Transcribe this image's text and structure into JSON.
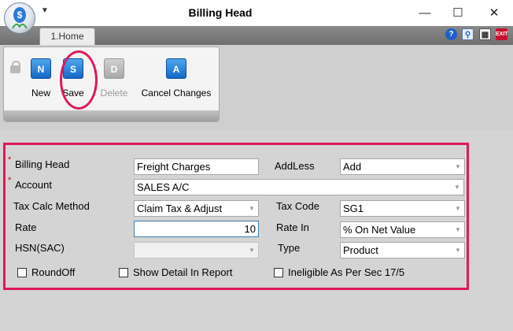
{
  "window": {
    "title": "Billing Head",
    "minimize": "—",
    "maximize": "☐",
    "close": "✕"
  },
  "tabs": [
    "1.Home"
  ],
  "ribbon": {
    "buttons": [
      {
        "label": "New",
        "icon": "N",
        "enabled": true
      },
      {
        "label": "Save",
        "icon": "S",
        "enabled": true
      },
      {
        "label": "Delete",
        "icon": "D",
        "enabled": false
      },
      {
        "label": "Cancel Changes",
        "icon": "A",
        "enabled": true
      }
    ]
  },
  "form": {
    "billing_head": {
      "label": "Billing Head",
      "value": "Freight Charges",
      "required": "*"
    },
    "add_less": {
      "label": "AddLess",
      "value": "Add"
    },
    "account": {
      "label": "Account",
      "value": "SALES A/C",
      "required": "*"
    },
    "tax_calc_method": {
      "label": "Tax Calc Method",
      "value": "Claim Tax & Adjust"
    },
    "tax_code": {
      "label": "Tax Code",
      "value": "SG1"
    },
    "rate": {
      "label": "Rate",
      "value": "10"
    },
    "rate_in": {
      "label": "Rate In",
      "value": "% On Net Value"
    },
    "hsn_sac": {
      "label": "HSN(SAC)",
      "value": ""
    },
    "type": {
      "label": "Type",
      "value": "Product"
    },
    "checkboxes": {
      "round_off": "RoundOff",
      "show_detail": "Show Detail In Report",
      "ineligible": "Ineligible As Per Sec 17/5"
    }
  },
  "colors": {
    "highlight": "#e0185b",
    "ribbon_icon": "#1468c6",
    "tab_strip": "#7a7a7a"
  },
  "icons": [
    "app-logo-icon",
    "help-icon",
    "search-icon",
    "calculator-icon",
    "exit-icon",
    "lock-icon"
  ]
}
